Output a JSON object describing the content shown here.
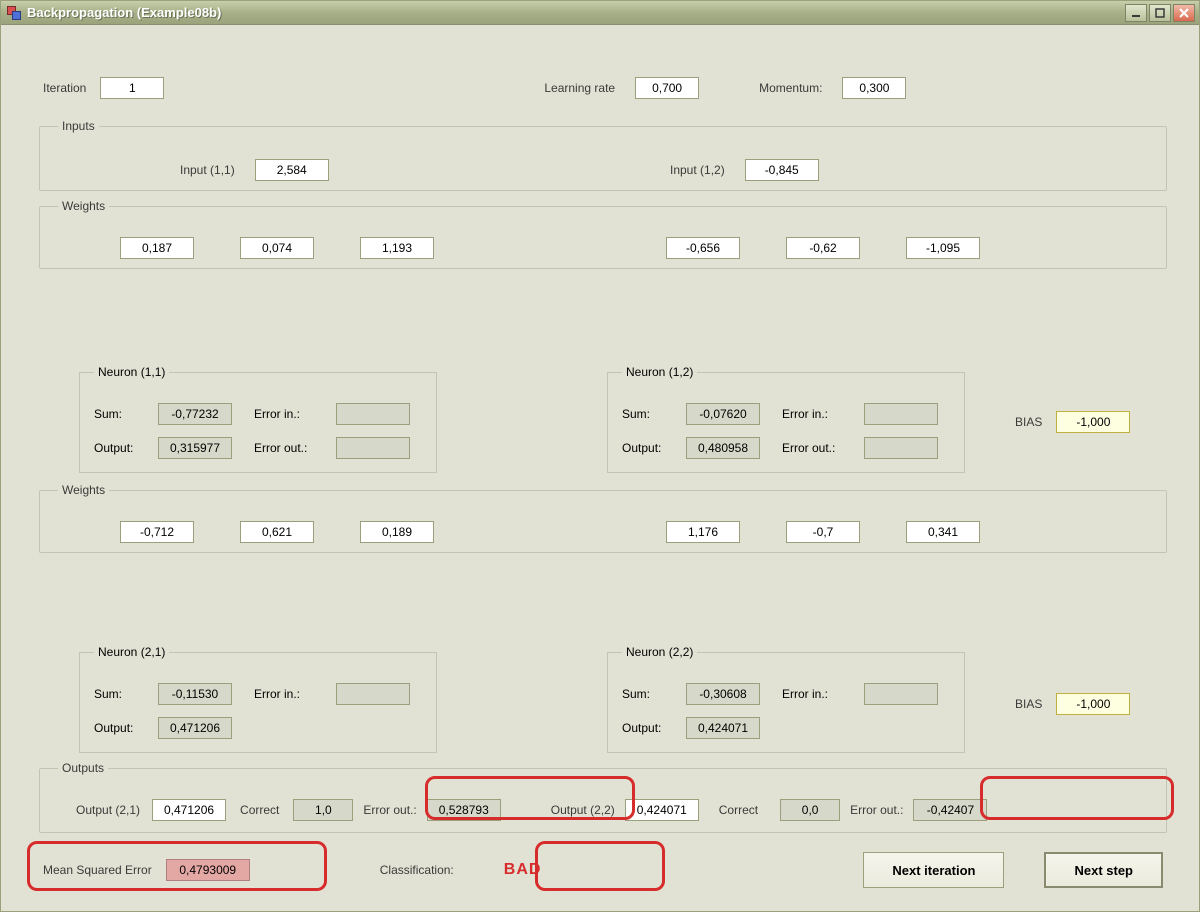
{
  "window": {
    "title": "Backpropagation (Example08b)"
  },
  "top": {
    "iter_label": "Iteration",
    "iter_value": "1",
    "lr_label": "Learning rate",
    "lr_value": "0,700",
    "mom_label": "Momentum:",
    "mom_value": "0,300"
  },
  "inputs": {
    "legend": "Inputs",
    "a_label": "Input (1,1)",
    "a_value": "2,584",
    "b_label": "Input (1,2)",
    "b_value": "-0,845"
  },
  "weights1": {
    "legend": "Weights",
    "left": [
      "0,187",
      "0,074",
      "1,193"
    ],
    "right": [
      "-0,656",
      "-0,62",
      "-1,095"
    ]
  },
  "weights2": {
    "legend": "Weights",
    "left": [
      "-0,712",
      "0,621",
      "0,189"
    ],
    "right": [
      "1,176",
      "-0,7",
      "0,341"
    ]
  },
  "bias": {
    "label": "BIAS",
    "v1": "-1,000",
    "v2": "-1,000"
  },
  "neurons": {
    "sum_label": "Sum:",
    "out_label": "Output:",
    "errin_label": "Error in.:",
    "errout_label": "Error out.:",
    "n11": {
      "legend": "Neuron (1,1)",
      "sum": "-0,77232",
      "out": "0,315977",
      "errin": "",
      "errout": ""
    },
    "n12": {
      "legend": "Neuron (1,2)",
      "sum": "-0,07620",
      "out": "0,480958",
      "errin": "",
      "errout": ""
    },
    "n21": {
      "legend": "Neuron (2,1)",
      "sum": "-0,11530",
      "out": "0,471206",
      "errin": "",
      "errout": ""
    },
    "n22": {
      "legend": "Neuron (2,2)",
      "sum": "-0,30608",
      "out": "0,424071",
      "errin": "",
      "errout": ""
    }
  },
  "outputs": {
    "legend": "Outputs",
    "o1_label": "Output (2,1)",
    "o1_value": "0,471206",
    "correct_label": "Correct",
    "o1_correct": "1,0",
    "errout_label": "Error out.:",
    "o1_errout": "0,528793",
    "o2_label": "Output (2,2)",
    "o2_value": "0,424071",
    "o2_correct": "0,0",
    "o2_errout": "-0,42407"
  },
  "bottom": {
    "mse_label": "Mean Squared Error",
    "mse_value": "0,4793009",
    "class_label": "Classification:",
    "class_value": "BAD",
    "btn_next_iter": "Next iteration",
    "btn_next_step": "Next step"
  }
}
